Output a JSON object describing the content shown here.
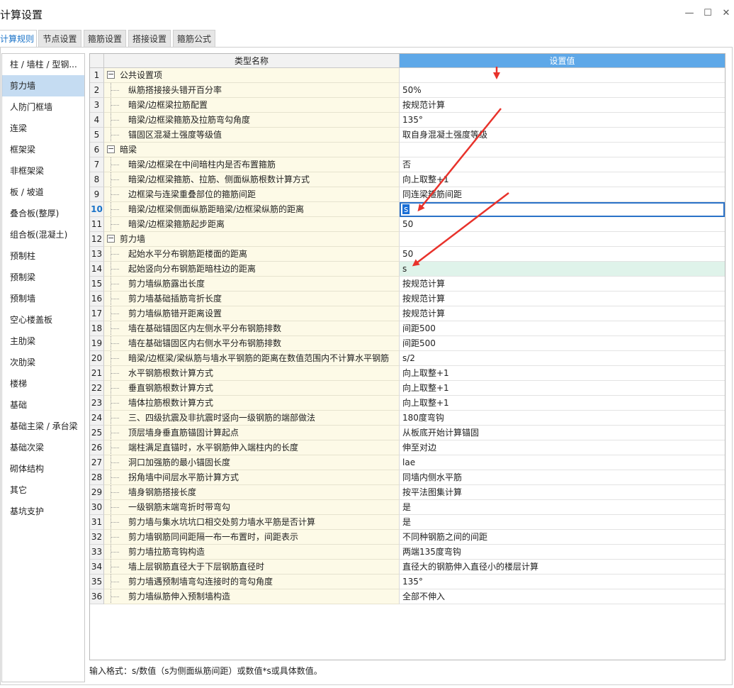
{
  "window": {
    "title": "计算设置",
    "minimize_glyph": "—",
    "maximize_glyph": "☐",
    "close_glyph": "✕"
  },
  "tabs": [
    {
      "label": "计算规则",
      "active": true
    },
    {
      "label": "节点设置",
      "active": false
    },
    {
      "label": "箍筋设置",
      "active": false
    },
    {
      "label": "搭接设置",
      "active": false
    },
    {
      "label": "箍筋公式",
      "active": false
    }
  ],
  "sidebar": {
    "items": [
      {
        "label": "柱 / 墙柱 / 型钢..."
      },
      {
        "label": "剪力墙",
        "selected": true
      },
      {
        "label": "人防门框墙"
      },
      {
        "label": "连梁"
      },
      {
        "label": "框架梁"
      },
      {
        "label": "非框架梁"
      },
      {
        "label": "板 / 坡道"
      },
      {
        "label": "叠合板(整厚)"
      },
      {
        "label": "组合板(混凝土)"
      },
      {
        "label": "预制柱"
      },
      {
        "label": "预制梁"
      },
      {
        "label": "预制墙"
      },
      {
        "label": "空心楼盖板"
      },
      {
        "label": "主肋梁"
      },
      {
        "label": "次肋梁"
      },
      {
        "label": "楼梯"
      },
      {
        "label": "基础"
      },
      {
        "label": "基础主梁 / 承台梁"
      },
      {
        "label": "基础次梁"
      },
      {
        "label": "砌体结构"
      },
      {
        "label": "其它"
      },
      {
        "label": "基坑支护"
      }
    ]
  },
  "grid": {
    "headers": {
      "name": "类型名称",
      "value": "设置值"
    },
    "rows": [
      {
        "num": "1",
        "name": "公共设置项",
        "value": "",
        "group": true,
        "toggle": "−"
      },
      {
        "num": "2",
        "name": "纵筋搭接接头错开百分率",
        "value": "50%"
      },
      {
        "num": "3",
        "name": "暗梁/边框梁拉筋配置",
        "value": "按规范计算"
      },
      {
        "num": "4",
        "name": "暗梁/边框梁箍筋及拉筋弯勾角度",
        "value": "135°"
      },
      {
        "num": "5",
        "name": "锚固区混凝土强度等级值",
        "value": "取自身混凝土强度等级"
      },
      {
        "num": "6",
        "name": "暗梁",
        "value": "",
        "group": true,
        "toggle": "−"
      },
      {
        "num": "7",
        "name": "暗梁/边框梁在中间暗柱内是否布置箍筋",
        "value": "否"
      },
      {
        "num": "8",
        "name": "暗梁/边框梁箍筋、拉筋、侧面纵筋根数计算方式",
        "value": "向上取整+1"
      },
      {
        "num": "9",
        "name": "边框梁与连梁重叠部位的箍筋间距",
        "value": "同连梁箍筋间距"
      },
      {
        "num": "10",
        "name": "暗梁/边框梁侧面纵筋距暗梁/边框梁纵筋的距离",
        "value": "s",
        "editing": true
      },
      {
        "num": "11",
        "name": "暗梁/边框梁箍筋起步距离",
        "value": "50"
      },
      {
        "num": "12",
        "name": "剪力墙",
        "value": "",
        "group": true,
        "toggle": "−"
      },
      {
        "num": "13",
        "name": "起始水平分布钢筋距楼面的距离",
        "value": "50"
      },
      {
        "num": "14",
        "name": "起始竖向分布钢筋距暗柱边的距离",
        "value": "s",
        "highlight": true
      },
      {
        "num": "15",
        "name": "剪力墙纵筋露出长度",
        "value": "按规范计算"
      },
      {
        "num": "16",
        "name": "剪力墙基础插筋弯折长度",
        "value": "按规范计算"
      },
      {
        "num": "17",
        "name": "剪力墙纵筋错开距离设置",
        "value": "按规范计算"
      },
      {
        "num": "18",
        "name": "墙在基础锚固区内左侧水平分布钢筋排数",
        "value": "间距500"
      },
      {
        "num": "19",
        "name": "墙在基础锚固区内右侧水平分布钢筋排数",
        "value": "间距500"
      },
      {
        "num": "20",
        "name": "暗梁/边框梁/梁纵筋与墙水平钢筋的距离在数值范围内不计算水平钢筋",
        "value": "s/2"
      },
      {
        "num": "21",
        "name": "水平钢筋根数计算方式",
        "value": "向上取整+1"
      },
      {
        "num": "22",
        "name": "垂直钢筋根数计算方式",
        "value": "向上取整+1"
      },
      {
        "num": "23",
        "name": "墙体拉筋根数计算方式",
        "value": "向上取整+1"
      },
      {
        "num": "24",
        "name": "三、四级抗震及非抗震时竖向一级钢筋的端部做法",
        "value": "180度弯钩"
      },
      {
        "num": "25",
        "name": "顶层墙身垂直筋锚固计算起点",
        "value": "从板底开始计算锚固"
      },
      {
        "num": "26",
        "name": "端柱满足直锚时，水平钢筋伸入端柱内的长度",
        "value": "伸至对边"
      },
      {
        "num": "27",
        "name": "洞口加强筋的最小锚固长度",
        "value": "lae"
      },
      {
        "num": "28",
        "name": "拐角墙中间层水平筋计算方式",
        "value": "同墙内侧水平筋"
      },
      {
        "num": "29",
        "name": "墙身钢筋搭接长度",
        "value": "按平法图集计算"
      },
      {
        "num": "30",
        "name": "一级钢筋末端弯折时带弯勾",
        "value": "是"
      },
      {
        "num": "31",
        "name": "剪力墙与集水坑坑口相交处剪力墙水平筋是否计算",
        "value": "是"
      },
      {
        "num": "32",
        "name": "剪力墙钢筋同间距隔一布一布置时，间距表示",
        "value": "不同种钢筋之间的间距"
      },
      {
        "num": "33",
        "name": "剪力墙拉筋弯钩构造",
        "value": "两端135度弯钩"
      },
      {
        "num": "34",
        "name": "墙上层钢筋直径大于下层钢筋直径时",
        "value": "直径大的钢筋伸入直径小的楼层计算"
      },
      {
        "num": "35",
        "name": "剪力墙遇预制墙弯勾连接时的弯勾角度",
        "value": "135°"
      },
      {
        "num": "36",
        "name": "剪力墙纵筋伸入预制墙构造",
        "value": "全部不伸入"
      }
    ]
  },
  "footer": {
    "hint": "输入格式：s/数值（s为侧面纵筋间距）或数值*s或具体数值。"
  },
  "colors": {
    "accent": "#5ea8e8",
    "name_column_bg": "#fdfae7",
    "highlight_row": "#dff3ea",
    "annotation_arrow": "#e8322b"
  }
}
